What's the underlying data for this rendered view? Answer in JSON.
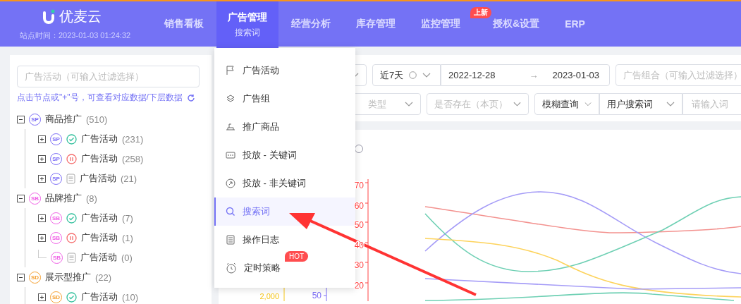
{
  "header": {
    "logo": "优麦云",
    "station_time": "站点时间：2023-01-03 01:24:32",
    "nav": [
      {
        "label": "销售看板",
        "selected": false
      },
      {
        "label": "广告管理",
        "selected": true,
        "sub": "搜索词"
      },
      {
        "label": "经营分析",
        "selected": false
      },
      {
        "label": "库存管理",
        "selected": false
      },
      {
        "label": "监控管理",
        "selected": false,
        "badge": "上新"
      },
      {
        "label": "授权&设置",
        "selected": false
      },
      {
        "label": "ERP",
        "selected": false
      }
    ]
  },
  "sidebar": {
    "search": {
      "placeholder": "广告活动（可输入过滤选择）"
    },
    "hint": "点击节点或\"+\"号，可查看对应数据/下层数据",
    "tree": [
      {
        "badge": "SP",
        "color": "#7b6cf6",
        "label": "商品推广",
        "count": "(510)",
        "expanded": true,
        "children": [
          {
            "badge": "SP",
            "color": "#7b6cf6",
            "kind": "enabled",
            "label": "广告活动",
            "count": "(231)",
            "expanded": false
          },
          {
            "badge": "SP",
            "color": "#7b6cf6",
            "kind": "paused",
            "label": "广告活动",
            "count": "(258)",
            "expanded": false
          },
          {
            "badge": "SP",
            "color": "#7b6cf6",
            "kind": "archived",
            "label": "广告活动",
            "count": "(21)",
            "expanded": false
          }
        ]
      },
      {
        "badge": "SB",
        "color": "#f060e6",
        "label": "品牌推广",
        "count": "(8)",
        "expanded": true,
        "children": [
          {
            "badge": "SB",
            "color": "#f060e6",
            "kind": "enabled",
            "label": "广告活动",
            "count": "(7)",
            "expanded": false
          },
          {
            "badge": "SB",
            "color": "#f060e6",
            "kind": "paused",
            "label": "广告活动",
            "count": "(1)",
            "expanded": false
          },
          {
            "badge": "SB",
            "color": "#f060e6",
            "kind": "archived",
            "label": "广告活动",
            "count": "(0)"
          }
        ]
      },
      {
        "badge": "SD",
        "color": "#f5a030",
        "label": "展示型推广",
        "count": "(22)",
        "expanded": true,
        "children": [
          {
            "badge": "SD",
            "color": "#f5a030",
            "kind": "enabled",
            "label": "广告活动",
            "count": "(10)",
            "expanded": false
          }
        ]
      }
    ]
  },
  "filters": {
    "period": "近7天",
    "date_start": "2022-12-28",
    "date_separator": "→",
    "date_end": "2023-01-03",
    "group": {
      "placeholder": "广告组合（可输入过滤选择）"
    },
    "type": {
      "placeholder": "类型"
    },
    "exists": {
      "placeholder": "是否存在（本页）"
    },
    "match": "模糊查询",
    "field": "用户搜索词",
    "word": {
      "placeholder": "请输入词"
    }
  },
  "chart": {
    "red_ticks": [
      "70",
      "60",
      "50",
      "40",
      "30",
      "20"
    ],
    "yellow_tick": "2,000",
    "blue_tick": "50"
  },
  "menu": {
    "items": [
      {
        "kind": "flag",
        "label": "广告活动",
        "selected": false
      },
      {
        "kind": "layers",
        "label": "广告组",
        "selected": false
      },
      {
        "kind": "product",
        "label": "推广商品",
        "selected": false
      },
      {
        "kind": "keyword",
        "label": "投放 - 关键词",
        "selected": false
      },
      {
        "kind": "target",
        "label": "投放 - 非关键词",
        "selected": false
      },
      {
        "kind": "search",
        "label": "搜索词",
        "selected": true
      },
      {
        "kind": "log",
        "label": "操作日志",
        "selected": false
      },
      {
        "kind": "clock",
        "label": "定时策略",
        "selected": false,
        "badge": "HOT"
      }
    ]
  }
}
